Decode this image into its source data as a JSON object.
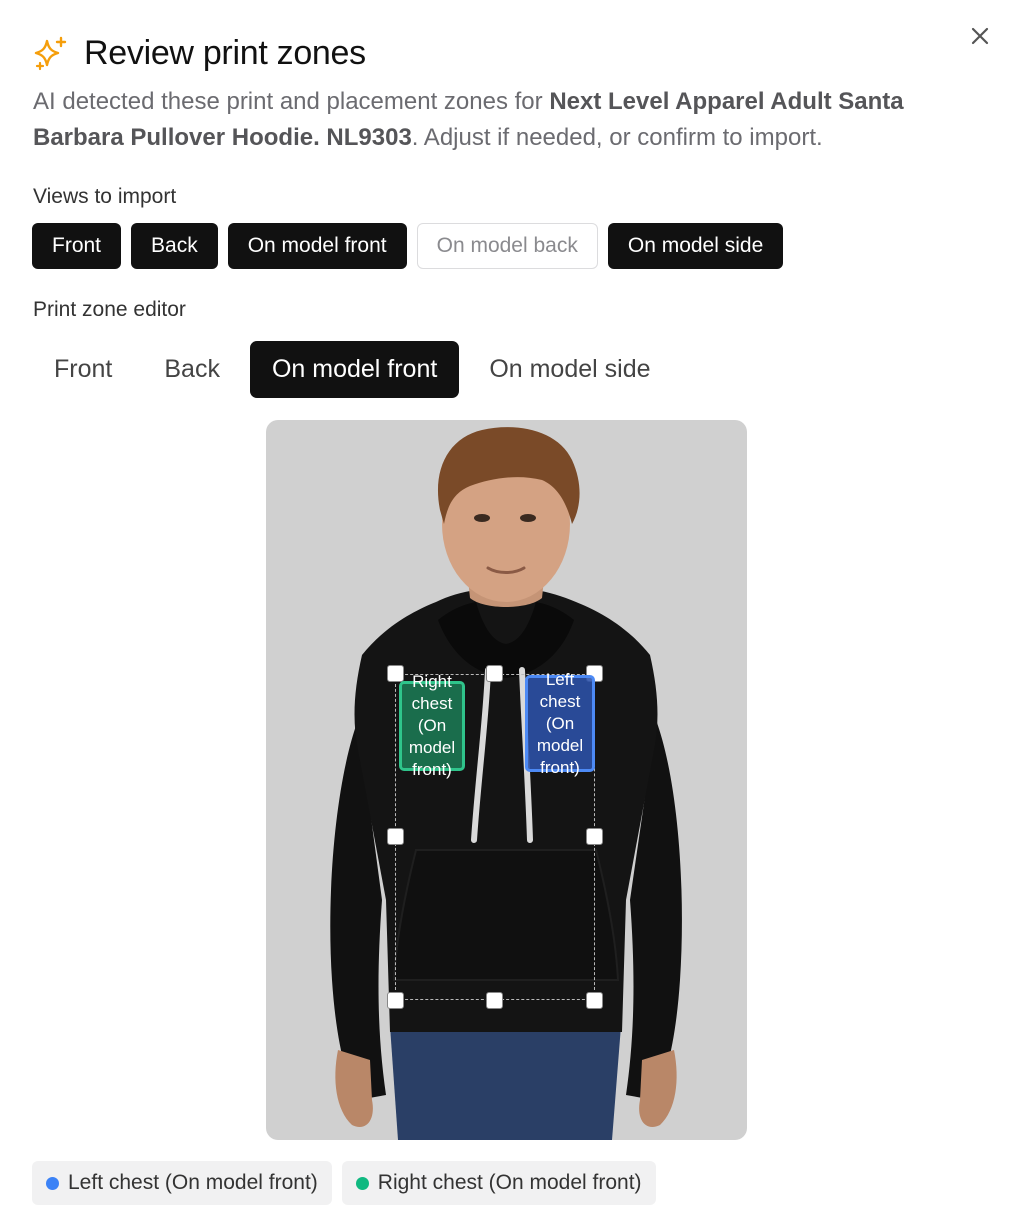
{
  "dialog": {
    "title": "Review print zones",
    "description": {
      "prefix": "AI detected these print and placement zones for ",
      "product": "Next Level Apparel Adult Santa Barbara Pullover Hoodie. NL9303",
      "suffix": ". Adjust if needed, or confirm to import."
    },
    "close_icon": "close-icon",
    "title_icon": "sparkle-icon"
  },
  "views_to_import": {
    "label": "Views to import",
    "chips": [
      {
        "label": "Front",
        "selected": true
      },
      {
        "label": "Back",
        "selected": true
      },
      {
        "label": "On model front",
        "selected": true
      },
      {
        "label": "On model back",
        "selected": false
      },
      {
        "label": "On model side",
        "selected": true
      }
    ]
  },
  "editor": {
    "label": "Print zone editor",
    "tabs": [
      {
        "label": "Front",
        "active": false
      },
      {
        "label": "Back",
        "active": false
      },
      {
        "label": "On model front",
        "active": true
      },
      {
        "label": "On model side",
        "active": false
      }
    ],
    "zones": [
      {
        "label": "Right chest (On model front)",
        "lines": [
          "Right",
          "chest",
          "(On",
          "model",
          "front)"
        ],
        "color": "#2fc48b"
      },
      {
        "label": "Left chest (On model front)",
        "lines": [
          "Left",
          "chest",
          "(On",
          "model",
          "front)"
        ],
        "color": "#4d8af5"
      }
    ]
  },
  "legend": [
    {
      "label": "Left chest (On model front)",
      "color": "#3b82f6"
    },
    {
      "label": "Right chest (On model front)",
      "color": "#10b981"
    }
  ],
  "colors": {
    "chip_selected_bg": "#111111",
    "canvas_bg": "#d0d0d0",
    "accent_sparkle": "#f59e0b"
  }
}
